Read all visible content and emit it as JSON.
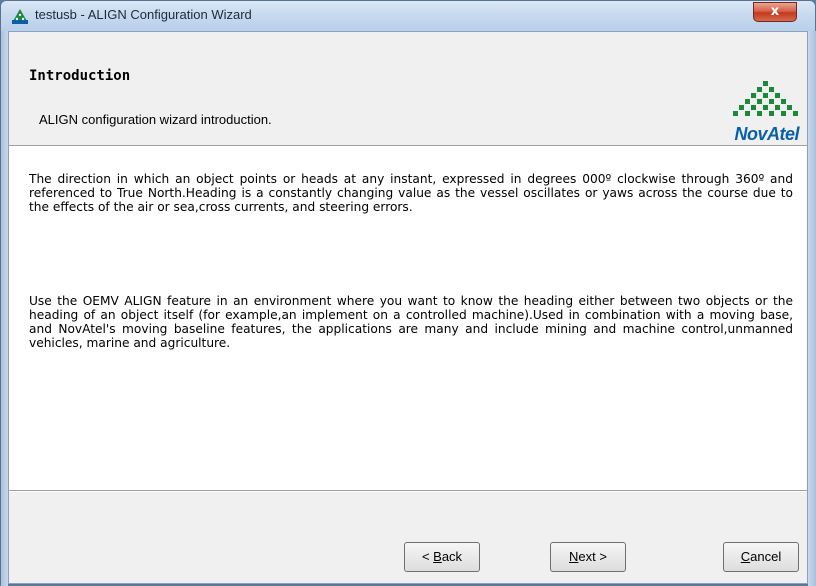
{
  "window": {
    "title": "testusb - ALIGN Configuration Wizard",
    "close_label": "x"
  },
  "header": {
    "title": "Introduction",
    "subtitle": "ALIGN configuration wizard introduction.",
    "logo_text": "NovAtel"
  },
  "content": {
    "paragraph1": "The direction in which an object points or heads at any instant, expressed in degrees 000º clockwise through 360º and referenced to True North.Heading is a constantly changing value as the vessel oscillates or yaws across the course due to the effects of the air or sea,cross currents, and steering errors.",
    "paragraph2": "Use the OEMV ALIGN feature in an environment where you want to know the heading either between two objects or the heading of an object itself (for example,an implement on a controlled machine).Used in combination with a moving base, and NovAtel's moving baseline features, the applications are many and include mining and machine control,unmanned vehicles, marine and agriculture."
  },
  "buttons": {
    "back_prefix": "< ",
    "back_mnemonic": "B",
    "back_rest": "ack",
    "next_mnemonic": "N",
    "next_rest": "ext >",
    "cancel_mnemonic": "C",
    "cancel_rest": "ancel"
  },
  "colors": {
    "logo_blue": "#0a5fa8",
    "logo_green": "#1a8a3a",
    "close_red": "#c4391d"
  },
  "icons": {
    "app": "novatel-app-icon",
    "logo": "novatel-logo"
  }
}
